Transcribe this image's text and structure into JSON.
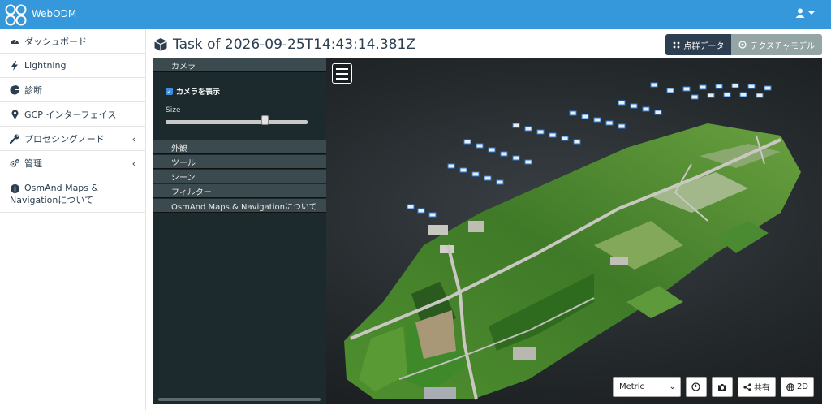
{
  "app": {
    "brand": "WebODM"
  },
  "sidebar": {
    "items": [
      {
        "label": "ダッシュボード",
        "icon": "dashboard-icon"
      },
      {
        "label": "Lightning",
        "icon": "bolt-icon"
      },
      {
        "label": "診断",
        "icon": "pie-chart-icon"
      },
      {
        "label": "GCP インターフェイス",
        "icon": "map-marker-icon"
      },
      {
        "label": "プロセシングノード",
        "icon": "wrench-icon"
      },
      {
        "label": "管理",
        "icon": "gears-icon"
      },
      {
        "label_line1": "OsmAnd Maps &",
        "label_line2": "Navigationについて",
        "icon": "info-icon"
      }
    ]
  },
  "header": {
    "title": "Task of 2026-09-25T14:43:14.381Z",
    "point_cloud_button": "点群データ",
    "textured_model_button": "テクスチャモデル"
  },
  "viewer": {
    "panel": {
      "camera_header": "カメラ",
      "show_camera_label": "カメラを表示",
      "size_label": "Size",
      "size_value": 0.7,
      "sections": [
        "外観",
        "ツール",
        "シーン",
        "フィルター",
        "OsmAnd Maps & Navigationについて"
      ]
    },
    "toolbar": {
      "units_selected": "Metric",
      "share_label": "共有",
      "view_2d_label": "2D"
    }
  },
  "colors": {
    "topbar": "#3498db",
    "header_button_dark": "#2c3e50",
    "header_button_gray": "#95a5a6",
    "panel_bg": "#1c2a2e"
  }
}
